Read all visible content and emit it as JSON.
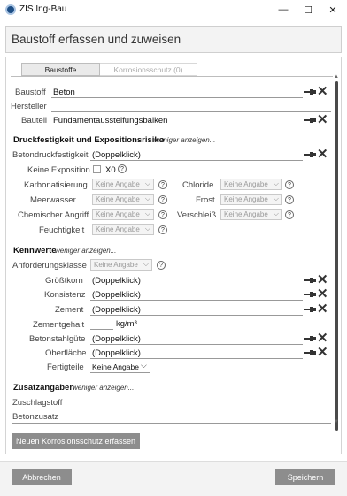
{
  "window": {
    "title": "ZIS Ing-Bau",
    "minimize": "—",
    "maximize": "☐",
    "close": "✕"
  },
  "header": {
    "title": "Baustoff erfassen und zuweisen"
  },
  "tabs": [
    {
      "label": "Baustoffe"
    },
    {
      "label": "Korrosionsschutz (0)"
    }
  ],
  "top_fields": {
    "baustoff_label": "Baustoff",
    "baustoff_value": "Beton",
    "hersteller_label": "Hersteller",
    "hersteller_value": "",
    "bauteil_label": "Bauteil",
    "bauteil_value": "Fundamentaussteifungsbalken"
  },
  "druck": {
    "title": "Druckfestigkeit und Expositionsrisiko",
    "more": "weniger anzeigen...",
    "beton_label": "Betondruckfestigkeit",
    "beton_value": "(Doppelklick)",
    "keine_label": "Keine Exposition",
    "x0": "X0",
    "karbo_label": "Karbonatisierung",
    "chlorid_label": "Chloride",
    "meer_label": "Meerwasser",
    "frost_label": "Frost",
    "chem_label": "Chemischer Angriff",
    "versch_label": "Verschleiß",
    "feucht_label": "Feuchtigkeit",
    "placeholder": "Keine Angabe"
  },
  "kenn": {
    "title": "Kennwerte",
    "more": "weniger anzeigen...",
    "anf_label": "Anforderungsklasse",
    "anf_value": "Keine Angabe",
    "groess_label": "Größtkorn",
    "groess_value": "(Doppelklick)",
    "konsist_label": "Konsistenz",
    "konsist_value": "(Doppelklick)",
    "zement_label": "Zement",
    "zement_value": "(Doppelklick)",
    "zg_label": "Zementgehalt",
    "zg_unit": "kg/m³",
    "bsg_label": "Betonstahlgüte",
    "bsg_value": "(Doppelklick)",
    "ober_label": "Oberfläche",
    "ober_value": "(Doppelklick)",
    "fert_label": "Fertigteile",
    "fert_value": "Keine Angabe"
  },
  "zusatz": {
    "title": "Zusatzangaben",
    "more": "weniger anzeigen...",
    "zuschlag_label": "Zuschlagstoff",
    "betonz_label": "Betonzusatz"
  },
  "actions": {
    "new_korrosion": "Neuen Korrosionsschutz erfassen",
    "cancel": "Abbrechen",
    "save": "Speichern"
  },
  "icons": {
    "pin": "pin-icon",
    "remove": "x-icon",
    "help": "help-icon",
    "dropdown": "chevron-down-icon"
  }
}
